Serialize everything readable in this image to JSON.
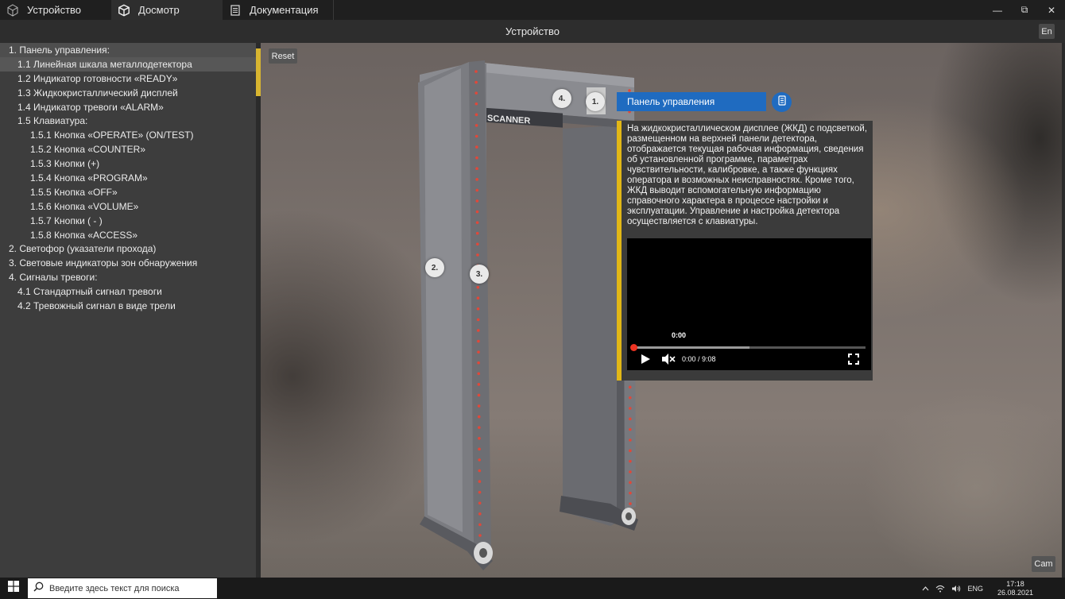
{
  "tabs": [
    {
      "label": "Устройство",
      "icon": "cube-outline-icon"
    },
    {
      "label": "Досмотр",
      "icon": "box-icon"
    },
    {
      "label": "Документация",
      "icon": "document-icon"
    }
  ],
  "window_controls": {
    "minimize": "—",
    "maximize": "⧉",
    "close": "✕"
  },
  "title": "Устройство",
  "lang_button": "En",
  "sidebar": {
    "items": [
      {
        "label": "1. Панель управления:",
        "level": 0
      },
      {
        "label": "1.1 Линейная шкала металлодетектора",
        "level": 1
      },
      {
        "label": "1.2 Индикатор готовности «READY»",
        "level": 1
      },
      {
        "label": "1.3 Жидкокристаллический дисплей",
        "level": 1
      },
      {
        "label": "1.4 Индикатор тревоги «ALARM»",
        "level": 1
      },
      {
        "label": "1.5 Клавиатура:",
        "level": 1
      },
      {
        "label": "1.5.1 Кнопка «OPERATE» (ON/TEST)",
        "level": 2
      },
      {
        "label": "1.5.2 Кнопка «COUNTER»",
        "level": 2
      },
      {
        "label": "1.5.3 Кнопки (+)",
        "level": 2
      },
      {
        "label": "1.5.4 Кнопка «PROGRAM»",
        "level": 2
      },
      {
        "label": "1.5.5 Кнопка «OFF»",
        "level": 2
      },
      {
        "label": "1.5.6 Кнопка «VOLUME»",
        "level": 2
      },
      {
        "label": "1.5.7 Кнопки ( - )",
        "level": 2
      },
      {
        "label": "1.5.8 Кнопка «ACCESS»",
        "level": 2
      },
      {
        "label": "2. Светофор (указатели прохода)",
        "level": 0
      },
      {
        "label": "3. Световые индикаторы зон обнаружения",
        "level": 0
      },
      {
        "label": "4. Сигналы тревоги:",
        "level": 0
      },
      {
        "label": "4.1 Стандартный сигнал тревоги",
        "level": 1
      },
      {
        "label": "4.2 Тревожный сигнал в виде трели",
        "level": 1
      }
    ]
  },
  "viewport": {
    "reset_label": "Reset",
    "cam_label": "Cam",
    "device_brand": "SCANNER",
    "markers": [
      "1.",
      "2.",
      "3.",
      "4."
    ]
  },
  "info_panel": {
    "title": "Панель управления",
    "icon": "device-icon",
    "text": "На жидкокристаллическом дисплее (ЖКД) с подсветкой, размещенном на верхней панели детектора, отображается текущая рабочая информация, сведения об установленной программе, параметрах чувствительности, калибровке, а также функциях оператора и возможных неисправностях. Кроме того, ЖКД выводит вспомогательную информацию справочного характера в процессе настройки и эксплуатации. Управление и настройка детектора осуществляется с клавиатуры.",
    "video": {
      "timecode": "0:00",
      "time_display": "0:00 / 9:08",
      "buffered_fraction": 0.5
    }
  },
  "taskbar": {
    "search_placeholder": "Введите здесь текст для поиска",
    "lang": "ENG",
    "time": "17:18",
    "date": "26.08.2021"
  },
  "colors": {
    "accent_blue": "#1f6bc0",
    "accent_yellow": "#e2b716",
    "led_red": "#e0483a"
  }
}
